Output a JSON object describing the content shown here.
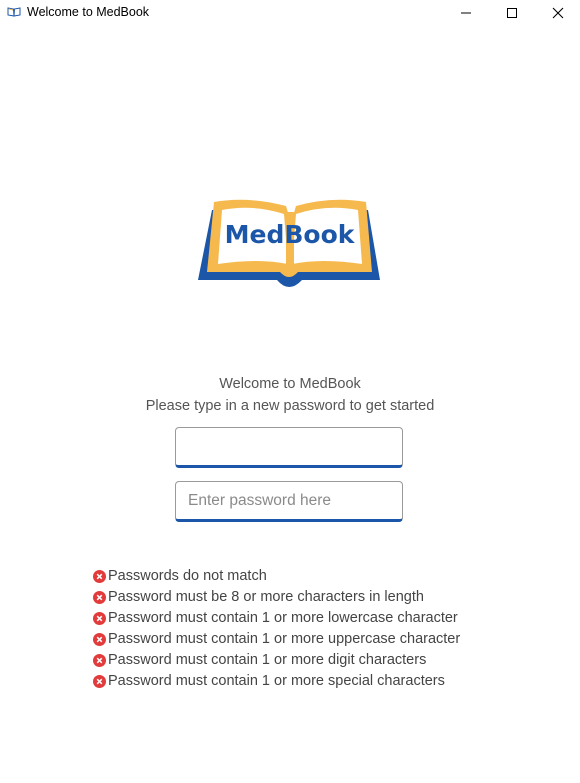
{
  "window": {
    "title": "Welcome to MedBook",
    "controls": [
      "minimize-icon",
      "maximize-icon",
      "close-icon"
    ]
  },
  "logo": {
    "text": "MedBook",
    "colors": {
      "blue": "#1c56a8",
      "orange": "#f6b94e"
    }
  },
  "welcome": {
    "title": "Welcome to MedBook",
    "subtitle": "Please type in a new password to get started"
  },
  "form": {
    "password": {
      "value": "",
      "placeholder": ""
    },
    "confirm": {
      "value": "",
      "placeholder": "Enter password here"
    }
  },
  "validation": {
    "icon": "error-x-icon",
    "icon_color": "#e23b3b",
    "rules": [
      "Passwords do not match",
      "Password must be 8 or more characters in length",
      "Password must contain 1 or more lowercase character",
      "Password must contain 1 or more uppercase character",
      "Password must contain 1 or more digit characters",
      "Password must contain 1 or more special characters"
    ]
  }
}
